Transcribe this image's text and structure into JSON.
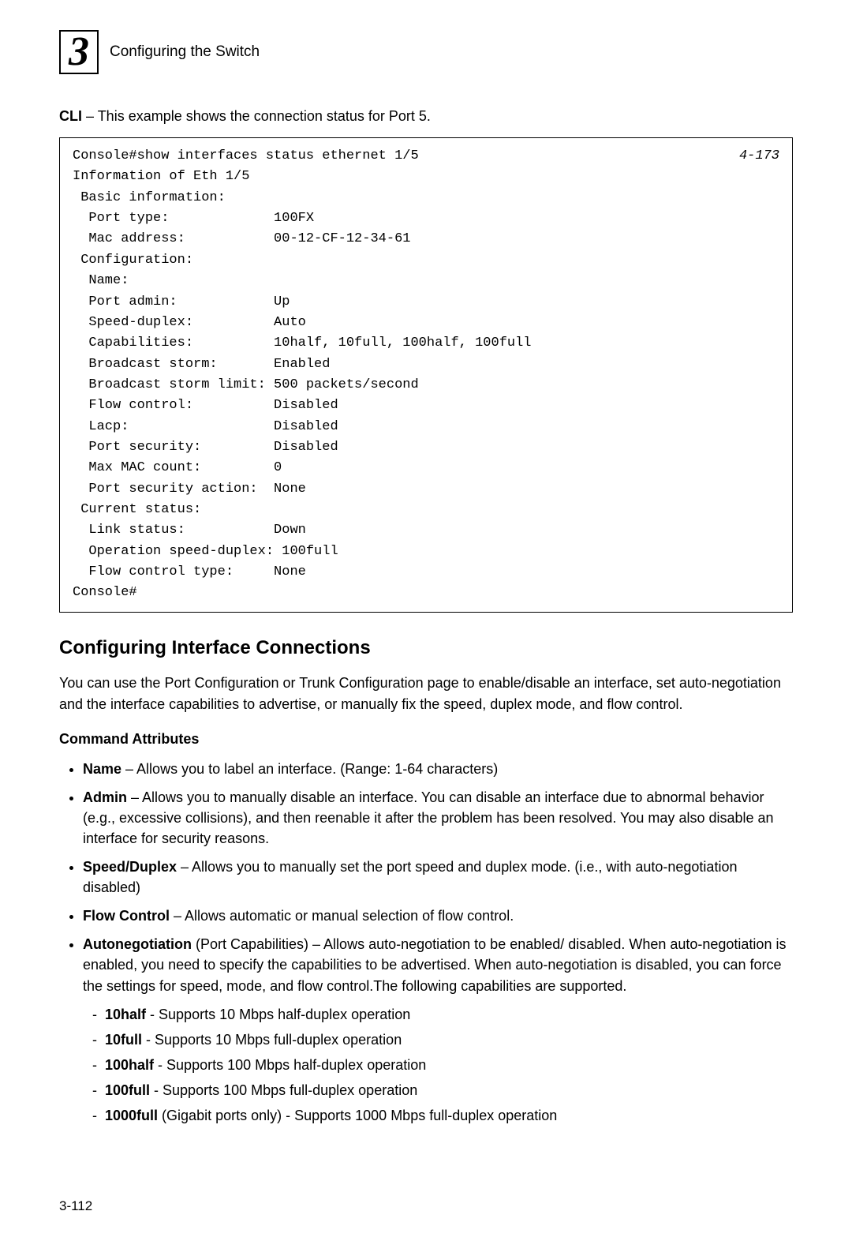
{
  "header": {
    "chapter_number": "3",
    "chapter_title": "Configuring the Switch"
  },
  "intro": {
    "cli_label": "CLI",
    "text": " – This example shows the connection status for Port 5."
  },
  "code": {
    "ref": "4-173",
    "content": "Console#show interfaces status ethernet 1/5\nInformation of Eth 1/5\n Basic information:\n  Port type:             100FX\n  Mac address:           00-12-CF-12-34-61\n Configuration:\n  Name:\n  Port admin:            Up\n  Speed-duplex:          Auto\n  Capabilities:          10half, 10full, 100half, 100full\n  Broadcast storm:       Enabled\n  Broadcast storm limit: 500 packets/second\n  Flow control:          Disabled\n  Lacp:                  Disabled\n  Port security:         Disabled\n  Max MAC count:         0\n  Port security action:  None\n Current status:\n  Link status:           Down\n  Operation speed-duplex: 100full\n  Flow control type:     None\nConsole#"
  },
  "section": {
    "heading": "Configuring Interface Connections",
    "intro_paragraph": "You can use the Port Configuration or Trunk Configuration page to enable/disable an interface, set auto-negotiation and the interface capabilities to advertise, or manually fix the speed, duplex mode, and flow control.",
    "command_attributes_label": "Command Attributes",
    "attrs": {
      "name": {
        "label": "Name",
        "desc": " – Allows you to label an interface. (Range: 1-64 characters)"
      },
      "admin": {
        "label": "Admin",
        "desc": " – Allows you to manually disable an interface. You can disable an interface due to abnormal behavior (e.g., excessive collisions), and then reenable it after the problem has been resolved. You may also disable an interface for security reasons."
      },
      "speed": {
        "label": "Speed/Duplex",
        "desc": " – Allows you to manually set the port speed and duplex mode. (i.e., with auto-negotiation disabled)"
      },
      "flow": {
        "label": "Flow Control",
        "desc": " – Allows automatic or manual selection of flow control."
      },
      "autoneg": {
        "label": "Autonegotiation",
        "sub": " (Port Capabilities) – Allows auto-negotiation to be enabled/ disabled. When auto-negotiation is enabled, you need to specify the capabilities to be advertised. When auto-negotiation is disabled, you can force the settings for speed, mode, and flow control.The following capabilities are supported.",
        "caps": {
          "c1": {
            "label": "10half",
            "desc": " - Supports 10 Mbps half-duplex operation"
          },
          "c2": {
            "label": "10full",
            "desc": " - Supports 10 Mbps full-duplex operation"
          },
          "c3": {
            "label": "100half",
            "desc": " - Supports 100 Mbps half-duplex operation"
          },
          "c4": {
            "label": "100full",
            "desc": " - Supports 100 Mbps full-duplex operation"
          },
          "c5": {
            "label": "1000full",
            "sub": " (Gigabit ports only) - Supports 1000 Mbps full-duplex operation"
          }
        }
      }
    }
  },
  "page_number": "3-112"
}
